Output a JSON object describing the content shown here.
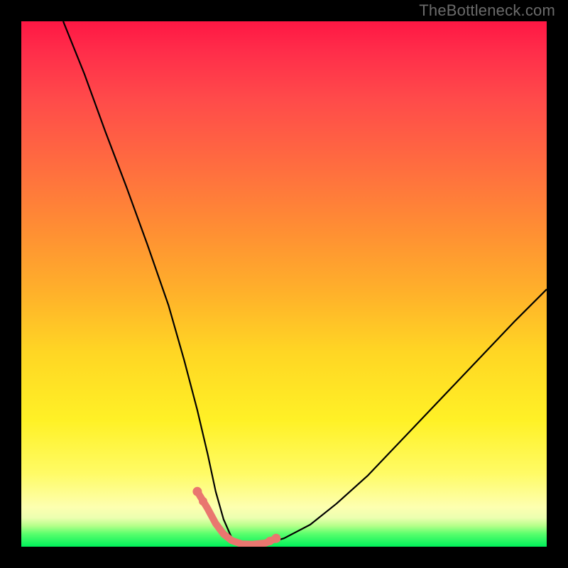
{
  "watermark": "TheBottleneck.com",
  "colors": {
    "page_bg": "#000000",
    "watermark_text": "#6b6b6b",
    "curve_main": "#000000",
    "curve_highlight": "#e9766f",
    "gradient_stops": [
      "#ff1744",
      "#ff4b4a",
      "#ff8f33",
      "#ffd624",
      "#fdffb0",
      "#00f05a"
    ]
  },
  "chart_data": {
    "type": "line",
    "title": "",
    "xlabel": "",
    "ylabel": "",
    "xlim": [
      0,
      100
    ],
    "ylim": [
      0,
      100
    ],
    "grid": false,
    "legend": false,
    "series": [
      {
        "name": "main-curve",
        "x": [
          8,
          12,
          16,
          20,
          24,
          28,
          31,
          33.5,
          35.5,
          37,
          38.5,
          40,
          42,
          44,
          46.5,
          50,
          55,
          60,
          66,
          74,
          84,
          94,
          100
        ],
        "y": [
          100,
          90,
          79,
          68.5,
          57.5,
          46,
          35.5,
          26,
          17.5,
          10.5,
          5.2,
          1.8,
          0.5,
          0.4,
          0.6,
          1.6,
          4.2,
          8.2,
          13.6,
          22,
          32.5,
          43,
          49
        ]
      },
      {
        "name": "bottom-highlight",
        "x": [
          33.5,
          35.5,
          37,
          38.5,
          40,
          42,
          44,
          46.5,
          48.5
        ],
        "y": [
          10.5,
          7.2,
          4.4,
          2.4,
          1.2,
          0.5,
          0.45,
          0.7,
          1.6
        ]
      }
    ],
    "annotations": []
  }
}
